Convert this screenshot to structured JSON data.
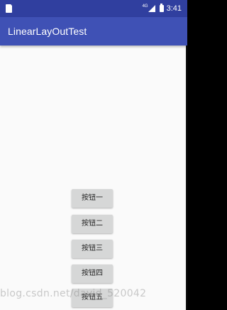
{
  "status_bar": {
    "network_type": "4G",
    "time": "3:41",
    "sim_icon": "sim-card-icon",
    "signal_icon": "cell-signal-icon",
    "battery_icon": "battery-icon"
  },
  "app_bar": {
    "title": "LinearLayOutTest"
  },
  "buttons": {
    "b1": "按钮一",
    "b2": "按钮二",
    "b3": "按钮三",
    "b4": "按钮四",
    "b5": "按钮五"
  },
  "watermark": "blog.csdn.net/david_520042",
  "colors": {
    "status_bar": "#303f9f",
    "app_bar": "#3f51b5",
    "background": "#fafafa",
    "button": "#d6d7d7"
  }
}
